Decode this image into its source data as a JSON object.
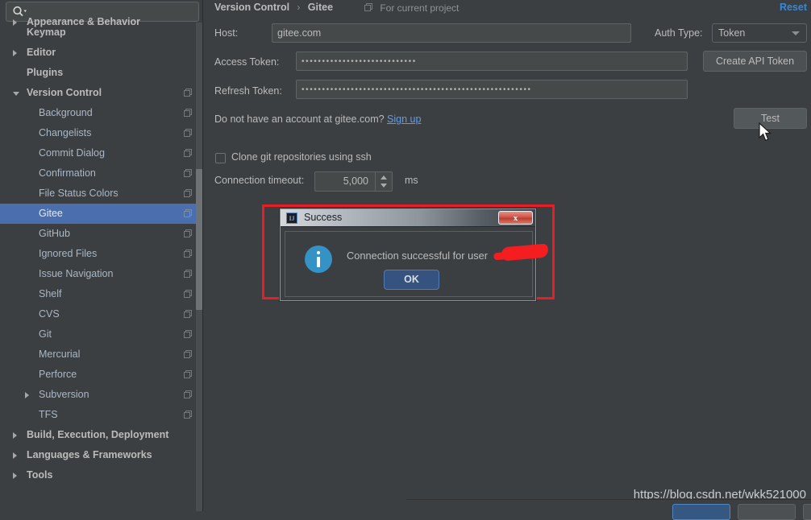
{
  "search": {
    "placeholder": "",
    "value": "",
    "icon": "search-icon"
  },
  "sidebar": {
    "clipped_item": "Appearance & Behavior",
    "items": [
      {
        "label": "Keymap",
        "indent": 33,
        "bold": true,
        "arrow": "none",
        "copy": false
      },
      {
        "label": "Editor",
        "indent": 33,
        "bold": true,
        "arrow": "right",
        "copy": false
      },
      {
        "label": "Plugins",
        "indent": 33,
        "bold": true,
        "arrow": "none",
        "copy": false
      },
      {
        "label": "Version Control",
        "indent": 33,
        "bold": true,
        "arrow": "down",
        "copy": true
      },
      {
        "label": "Background",
        "indent": 48,
        "bold": false,
        "arrow": "none",
        "copy": true
      },
      {
        "label": "Changelists",
        "indent": 48,
        "bold": false,
        "arrow": "none",
        "copy": true
      },
      {
        "label": "Commit Dialog",
        "indent": 48,
        "bold": false,
        "arrow": "none",
        "copy": true
      },
      {
        "label": "Confirmation",
        "indent": 48,
        "bold": false,
        "arrow": "none",
        "copy": true
      },
      {
        "label": "File Status Colors",
        "indent": 48,
        "bold": false,
        "arrow": "none",
        "copy": true
      },
      {
        "label": "Gitee",
        "indent": 48,
        "bold": false,
        "arrow": "none",
        "copy": true,
        "selected": true
      },
      {
        "label": "GitHub",
        "indent": 48,
        "bold": false,
        "arrow": "none",
        "copy": true
      },
      {
        "label": "Ignored Files",
        "indent": 48,
        "bold": false,
        "arrow": "none",
        "copy": true
      },
      {
        "label": "Issue Navigation",
        "indent": 48,
        "bold": false,
        "arrow": "none",
        "copy": true
      },
      {
        "label": "Shelf",
        "indent": 48,
        "bold": false,
        "arrow": "none",
        "copy": true
      },
      {
        "label": "CVS",
        "indent": 48,
        "bold": false,
        "arrow": "none",
        "copy": true
      },
      {
        "label": "Git",
        "indent": 48,
        "bold": false,
        "arrow": "none",
        "copy": true
      },
      {
        "label": "Mercurial",
        "indent": 48,
        "bold": false,
        "arrow": "none",
        "copy": true
      },
      {
        "label": "Perforce",
        "indent": 48,
        "bold": false,
        "arrow": "none",
        "copy": true
      },
      {
        "label": "Subversion",
        "indent": 48,
        "bold": false,
        "arrow": "right",
        "copy": true
      },
      {
        "label": "TFS",
        "indent": 48,
        "bold": false,
        "arrow": "none",
        "copy": true
      },
      {
        "label": "Build, Execution, Deployment",
        "indent": 33,
        "bold": true,
        "arrow": "right",
        "copy": false
      },
      {
        "label": "Languages & Frameworks",
        "indent": 33,
        "bold": true,
        "arrow": "right",
        "copy": false
      },
      {
        "label": "Tools",
        "indent": 33,
        "bold": true,
        "arrow": "right",
        "copy": false
      }
    ]
  },
  "header": {
    "breadcrumb_root": "Version Control",
    "breadcrumb_separator": "›",
    "breadcrumb_leaf": "Gitee",
    "scope_label": "For current project",
    "reset_label": "Reset"
  },
  "form": {
    "host_label": "Host:",
    "host_value": "gitee.com",
    "auth_type_label": "Auth Type:",
    "auth_type_value": "Token",
    "access_token_label": "Access Token:",
    "access_token_value": "••••••••••••••••••••••••••••",
    "refresh_token_label": "Refresh Token:",
    "refresh_token_value": "••••••••••••••••••••••••••••••••••••••••••••••••••••••••",
    "create_api_token_label": "Create API Token",
    "signup_question": "Do not have an account at gitee.com?",
    "signup_link_label": "Sign up",
    "test_label": "Test",
    "clone_ssh_label": "Clone git repositories using ssh",
    "clone_ssh_checked": false,
    "timeout_label": "Connection timeout:",
    "timeout_value": "5,000",
    "timeout_unit": "ms"
  },
  "dialog": {
    "app_icon_label": "IJ",
    "title": "Success",
    "close_label": "x",
    "message": "Connection successful for user",
    "ok_label": "OK",
    "info_icon": "info-icon"
  },
  "annotation": {
    "color": "#ec1c24"
  },
  "watermark": {
    "text": "https://blog.csdn.net/wkk521000"
  },
  "bottom_buttons": [
    {
      "name": "ok-peek",
      "label": ""
    },
    {
      "name": "cancel-peek",
      "label": ""
    },
    {
      "name": "apply-peek",
      "label": ""
    }
  ],
  "colors": {
    "background": "#3c3f41",
    "selection": "#4b6eaf",
    "link": "#589df6",
    "accent_reset": "#3b86d4",
    "info": "#3592c4",
    "redaction": "#f41d20"
  }
}
